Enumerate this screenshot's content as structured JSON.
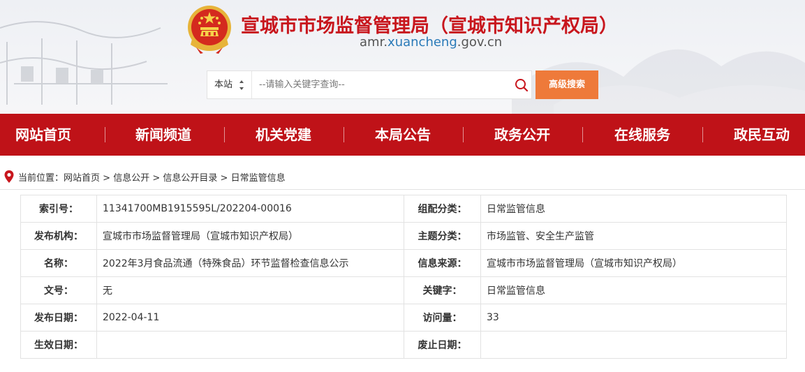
{
  "header": {
    "title": "宣城市市场监督管理局（宣城市知识产权局）",
    "domain_prefix": "amr.",
    "domain_highlight": "xuancheng",
    "domain_suffix": ".gov.cn",
    "title_color": "#c8161d"
  },
  "search": {
    "scope": "本站",
    "placeholder": "--请输入关键字查询--",
    "advanced_label": "高级搜索",
    "button_color": "#ee7a3a",
    "icon": "search-icon"
  },
  "nav": {
    "color": "#bf1218",
    "items": [
      "网站首页",
      "新闻频道",
      "机关党建",
      "本局公告",
      "政务公开",
      "在线服务",
      "政民互动"
    ]
  },
  "breadcrumb": {
    "prefix": "当前位置：",
    "items": [
      "网站首页",
      "信息公开",
      "信息公开目录",
      "日常监管信息"
    ],
    "separator": " > "
  },
  "info": {
    "rows": [
      {
        "l1": "索引号：",
        "v1": "11341700MB1915595L/202204-00016",
        "l2": "组配分类：",
        "v2": "日常监管信息"
      },
      {
        "l1": "发布机构：",
        "v1": "宣城市市场监督管理局（宣城市知识产权局）",
        "l2": "主题分类：",
        "v2": "市场监管、安全生产监管"
      },
      {
        "l1": "名称：",
        "v1": "2022年3月食品流通（特殊食品）环节监督检查信息公示",
        "l2": "信息来源：",
        "v2": "宣城市市场监督管理局（宣城市知识产权局）"
      },
      {
        "l1": "文号：",
        "v1": "无",
        "l2": "关键字：",
        "v2": "日常监管信息"
      },
      {
        "l1": "发布日期：",
        "v1": "2022-04-11",
        "l2": "访问量：",
        "v2": "33"
      },
      {
        "l1": "生效日期：",
        "v1": "",
        "l2": "废止日期：",
        "v2": ""
      }
    ]
  }
}
